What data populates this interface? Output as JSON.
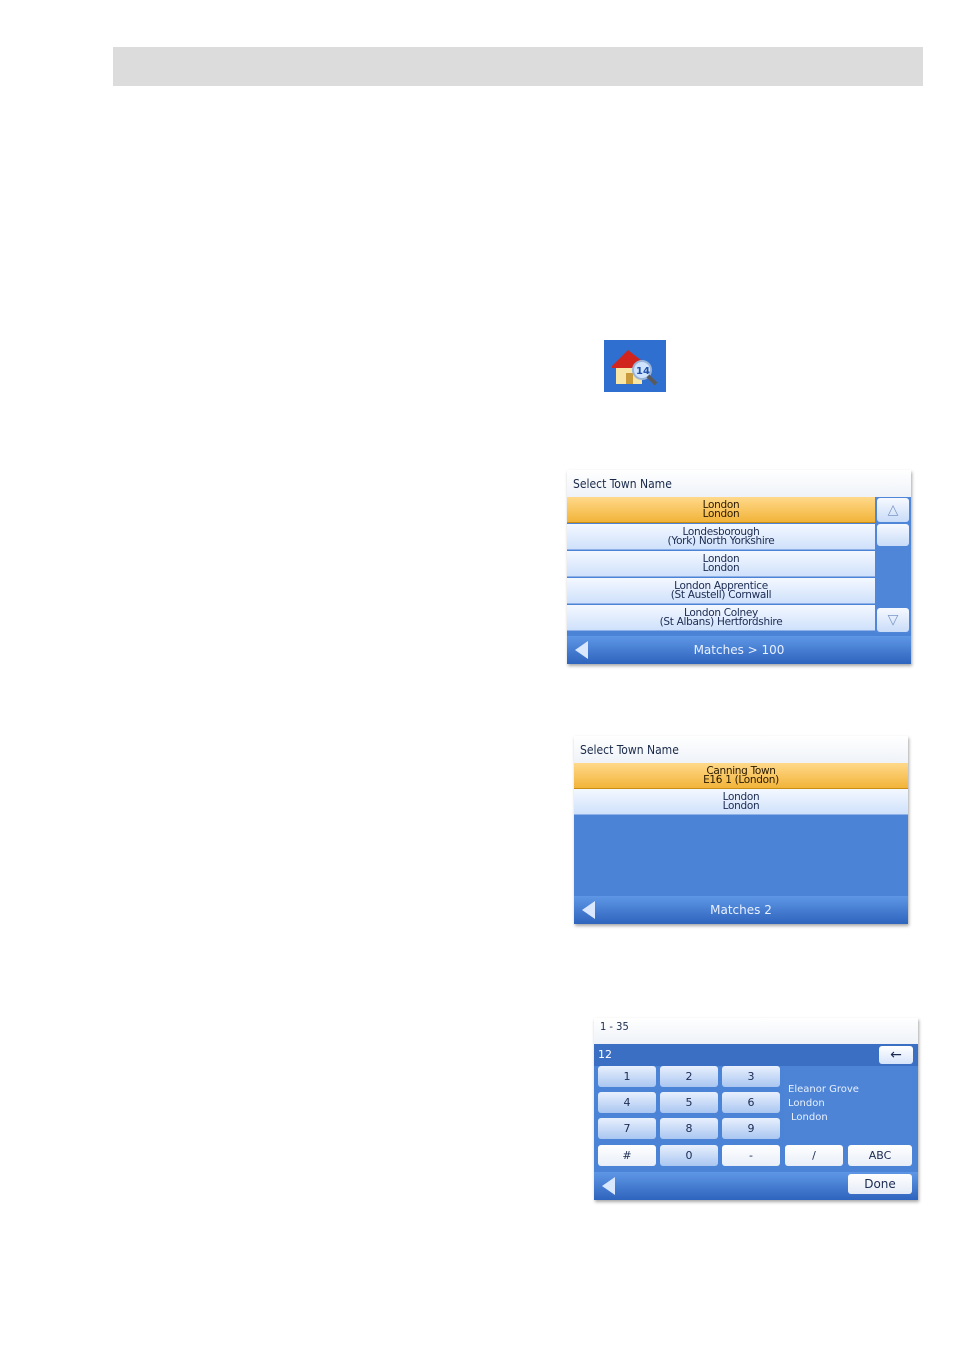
{
  "home_icon": {
    "name": "house-magnifier-icon",
    "badge": "14"
  },
  "screen1": {
    "title": "Select Town Name",
    "rows": [
      {
        "line1": "London",
        "line2": "London"
      },
      {
        "line1": "Londesborough",
        "line2": "(York) North Yorkshire"
      },
      {
        "line1": "London",
        "line2": "London"
      },
      {
        "line1": "London Apprentice",
        "line2": "(St Austell) Cornwall"
      },
      {
        "line1": "London Colney",
        "line2": "(St Albans) Hertfordshire"
      }
    ],
    "footer": "Matches  >  100"
  },
  "screen2": {
    "title": "Select Town Name",
    "rows": [
      {
        "line1": "Canning Town",
        "line2": "E16 1 (London)"
      },
      {
        "line1": "London",
        "line2": "London"
      }
    ],
    "footer": "Matches  2"
  },
  "screen3": {
    "range": "1 - 35",
    "input": "12",
    "backspace": "←",
    "keys": [
      "1",
      "2",
      "3",
      "4",
      "5",
      "6",
      "7",
      "8",
      "9"
    ],
    "bottom_keys": [
      "#",
      "0",
      "-",
      "/",
      "ABC"
    ],
    "address": [
      "Eleanor Grove",
      "London",
      "London"
    ],
    "done": "Done"
  },
  "colors": {
    "selected": "#f2b43a",
    "panel": "#4b83d6",
    "header_bar": "#dcdcdc"
  }
}
